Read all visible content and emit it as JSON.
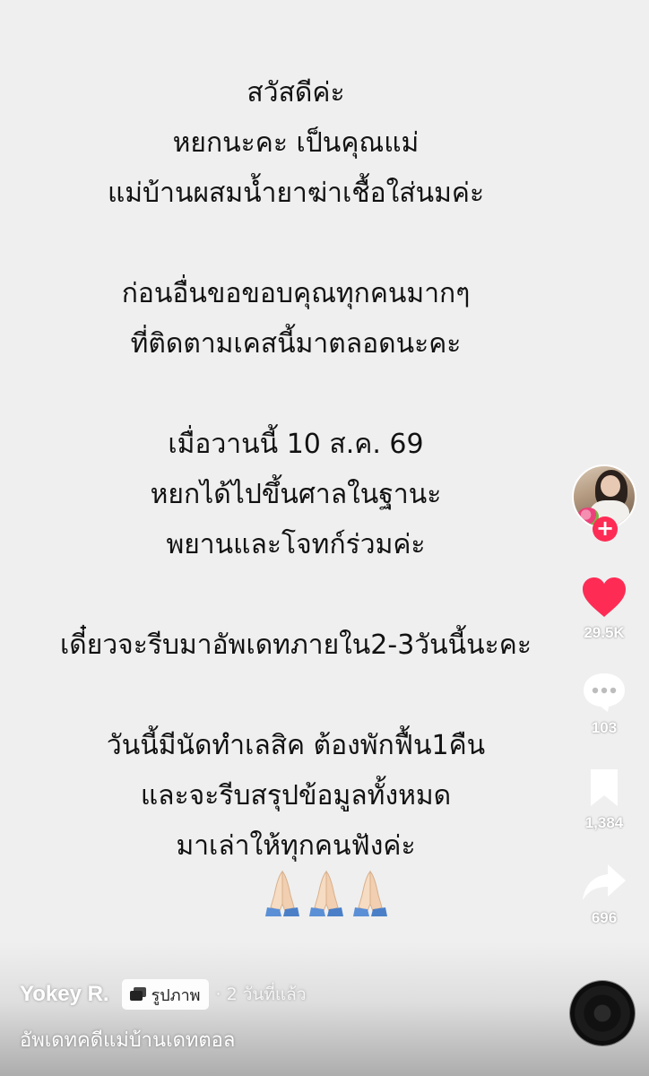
{
  "post": {
    "paragraphs": [
      [
        "สวัสดีค่ะ",
        "หยกนะคะ เป็นคุณแม่",
        "แม่บ้านผสมน้ำยาฆ่าเชื้อใส่นมค่ะ"
      ],
      [
        "ก่อนอื่นขอขอบคุณทุกคนมากๆ",
        "ที่ติดตามเคสนี้มาตลอดนะคะ"
      ],
      [
        "เมื่อวานนี้ 10 ส.ค. 69",
        "หยกได้ไปขึ้นศาลในฐานะ",
        "พยานและโจทก์ร่วมค่ะ"
      ],
      [
        "เดี๋ยวจะรีบมาอัพเดทภายใน2-3วันนี้นะคะ"
      ],
      [
        "วันนี้มีนัดทำเลสิค ต้องพักฟื้น1คืน",
        "และจะรีบสรุปข้อมูลทั้งหมด",
        "มาเล่าให้ทุกคนฟังค่ะ"
      ]
    ],
    "emoji": "🙏🙏🙏"
  },
  "rail": {
    "follow_symbol": "+",
    "likes": "29.5K",
    "comments": "103",
    "saves": "1,384",
    "shares": "696"
  },
  "info": {
    "author": "Yokey R.",
    "type_badge": "รูปภาพ",
    "time": "· 2 วันที่แล้ว",
    "caption": "อัพเดทคดีแม่บ้านเดทตอล"
  },
  "colors": {
    "background": "#efefef",
    "like": "#fe2c55",
    "follow": "#fe2c55"
  },
  "icons": [
    "plus-icon",
    "heart-icon",
    "comment-icon",
    "bookmark-icon",
    "share-icon",
    "photo-badge-icon",
    "music-disc-icon",
    "pray-emoji-icon"
  ]
}
